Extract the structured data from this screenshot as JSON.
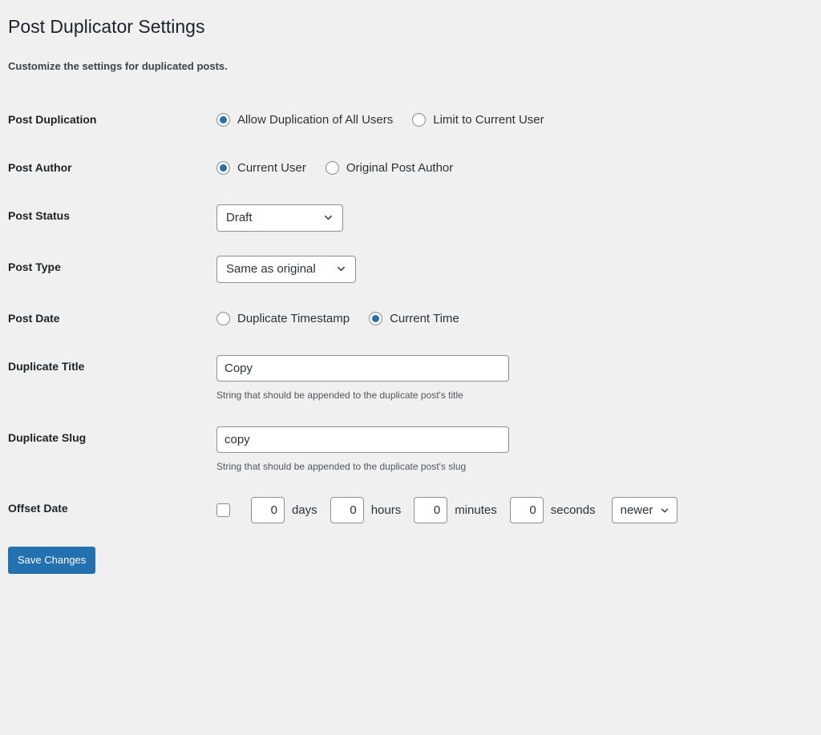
{
  "page": {
    "title": "Post Duplicator Settings",
    "subtitle": "Customize the settings for duplicated posts."
  },
  "fields": {
    "post_duplication": {
      "label": "Post Duplication",
      "options": [
        {
          "label": "Allow Duplication of All Users",
          "selected": true
        },
        {
          "label": "Limit to Current User",
          "selected": false
        }
      ]
    },
    "post_author": {
      "label": "Post Author",
      "options": [
        {
          "label": "Current User",
          "selected": true
        },
        {
          "label": "Original Post Author",
          "selected": false
        }
      ]
    },
    "post_status": {
      "label": "Post Status",
      "value": "Draft",
      "caret": "chevron-down-icon"
    },
    "post_type": {
      "label": "Post Type",
      "value": "Same as original",
      "caret": "chevron-down-icon"
    },
    "post_date": {
      "label": "Post Date",
      "options": [
        {
          "label": "Duplicate Timestamp",
          "selected": false
        },
        {
          "label": "Current Time",
          "selected": true
        }
      ]
    },
    "duplicate_title": {
      "label": "Duplicate Title",
      "value": "Copy",
      "help": "String that should be appended to the duplicate post's title"
    },
    "duplicate_slug": {
      "label": "Duplicate Slug",
      "value": "copy",
      "help": "String that should be appended to the duplicate post's slug"
    },
    "offset_date": {
      "label": "Offset Date",
      "enabled": false,
      "days": {
        "value": "0",
        "unit": "days"
      },
      "hours": {
        "value": "0",
        "unit": "hours"
      },
      "minutes": {
        "value": "0",
        "unit": "minutes"
      },
      "seconds": {
        "value": "0",
        "unit": "seconds"
      },
      "direction": "newer"
    }
  },
  "submit": {
    "label": "Save Changes"
  },
  "colors": {
    "background": "#f0f0f1",
    "accent": "#2271b1",
    "text": "#1d2327",
    "border": "#8c8f94"
  }
}
